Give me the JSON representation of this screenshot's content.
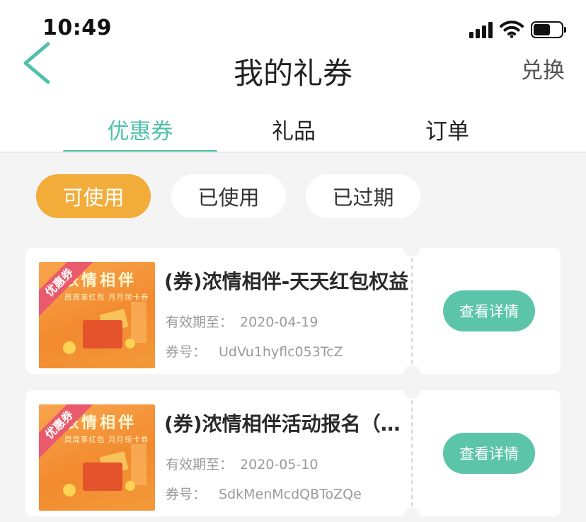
{
  "status_bar": {
    "time": "10:49",
    "icons": [
      "signal-icon",
      "wifi-icon",
      "battery-icon"
    ]
  },
  "header": {
    "title": "我的礼券",
    "back_icon": "chevron-left-icon",
    "action_label": "兑换"
  },
  "tabs": [
    {
      "label": "优惠券",
      "active": true
    },
    {
      "label": "礼品",
      "active": false
    },
    {
      "label": "订单",
      "active": false
    }
  ],
  "filters": [
    {
      "label": "可使用",
      "active": true
    },
    {
      "label": "已使用",
      "active": false
    },
    {
      "label": "已过期",
      "active": false
    }
  ],
  "coupons": [
    {
      "title": "(券)浓情相伴-天天红包权益",
      "valid_label": "有效期至：",
      "valid_date": "2020-04-19",
      "code_label": "券号：",
      "code": "UdVu1hyflc053TcZ",
      "button_label": "查看详情",
      "thumb": {
        "ribbon": "优惠券",
        "heading": "浓情相伴",
        "subtext": "周周享红包  月月领卡券"
      }
    },
    {
      "title": "(券)浓情相伴活动报名（…",
      "valid_label": "有效期至：",
      "valid_date": "2020-05-10",
      "code_label": "券号：",
      "code": "SdkMenMcdQBToZQe",
      "button_label": "查看详情",
      "thumb": {
        "ribbon": "优惠券",
        "heading": "浓情相伴",
        "subtext": "周周享红包  月月领卡券"
      }
    }
  ],
  "colors": {
    "accent": "#4fc1a8",
    "button": "#5cc5a9",
    "active_chip": "#f2ac3a",
    "background": "#f4f4f4"
  }
}
